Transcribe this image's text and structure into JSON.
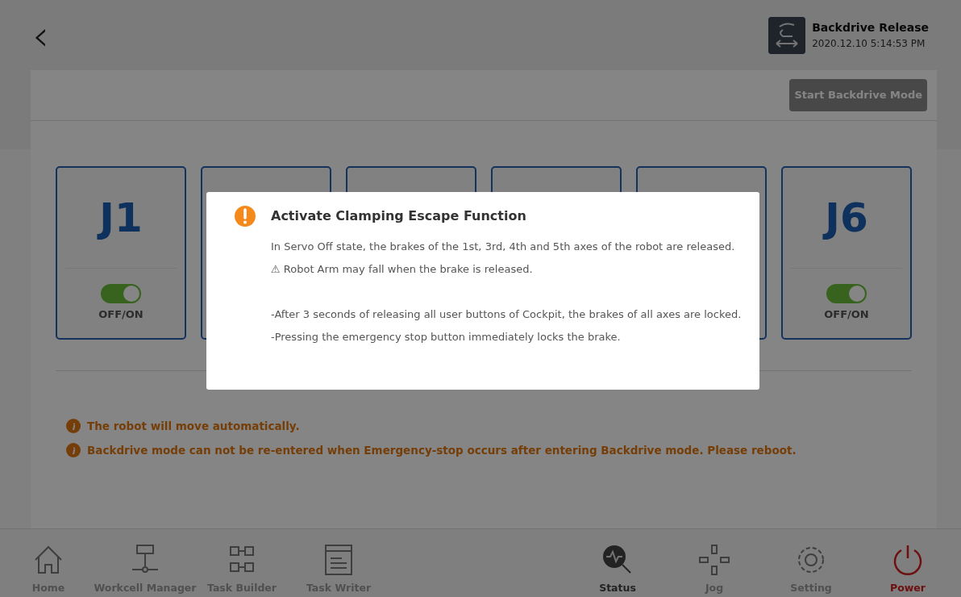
{
  "header": {
    "back": "‹",
    "status_title": "Backdrive Release",
    "status_time": "2020.12.10 5:14:53 PM"
  },
  "toolbar": {
    "start_button": {
      "label": "Start Backdrive Mode",
      "disabled": true
    }
  },
  "joints": [
    {
      "covered": false,
      "label": "J1",
      "switch_on": true,
      "switch_label": "OFF/ON"
    },
    {
      "covered": true
    },
    {
      "covered": true
    },
    {
      "covered": true
    },
    {
      "covered": true
    },
    {
      "covered": false,
      "label": "J6",
      "switch_on": true,
      "switch_label": "OFF/ON"
    }
  ],
  "warnings": [
    "The robot will move automatically.",
    "Backdrive mode can not be re-entered when Emergency-stop occurs after entering Backdrive mode. Please reboot."
  ],
  "dialog": {
    "title": "Activate Clamping Escape Function",
    "sections": [
      [
        "In Servo Off state, the brakes of the 1st, 3rd, 4th and 5th axes of the robot are released.",
        "⚠ Robot Arm may fall when the brake is released."
      ],
      [
        "-After 3 seconds of releasing all user buttons of Cockpit, the brakes of all axes are locked.",
        "-Pressing the emergency stop button immediately locks the brake."
      ]
    ]
  },
  "nav_left": [
    {
      "kind": "home",
      "label": "Home",
      "disabled": true
    },
    {
      "kind": "workcell",
      "label": "Workcell Manager",
      "disabled": true
    },
    {
      "kind": "builder",
      "label": "Task Builder",
      "disabled": true
    },
    {
      "kind": "writer",
      "label": "Task Writer",
      "disabled": true
    }
  ],
  "nav_right": [
    {
      "kind": "status",
      "label": "Status",
      "disabled": false
    },
    {
      "kind": "jog",
      "label": "Jog",
      "disabled": true
    },
    {
      "kind": "setting",
      "label": "Setting",
      "disabled": true
    },
    {
      "kind": "power",
      "label": "Power",
      "disabled": false
    }
  ]
}
